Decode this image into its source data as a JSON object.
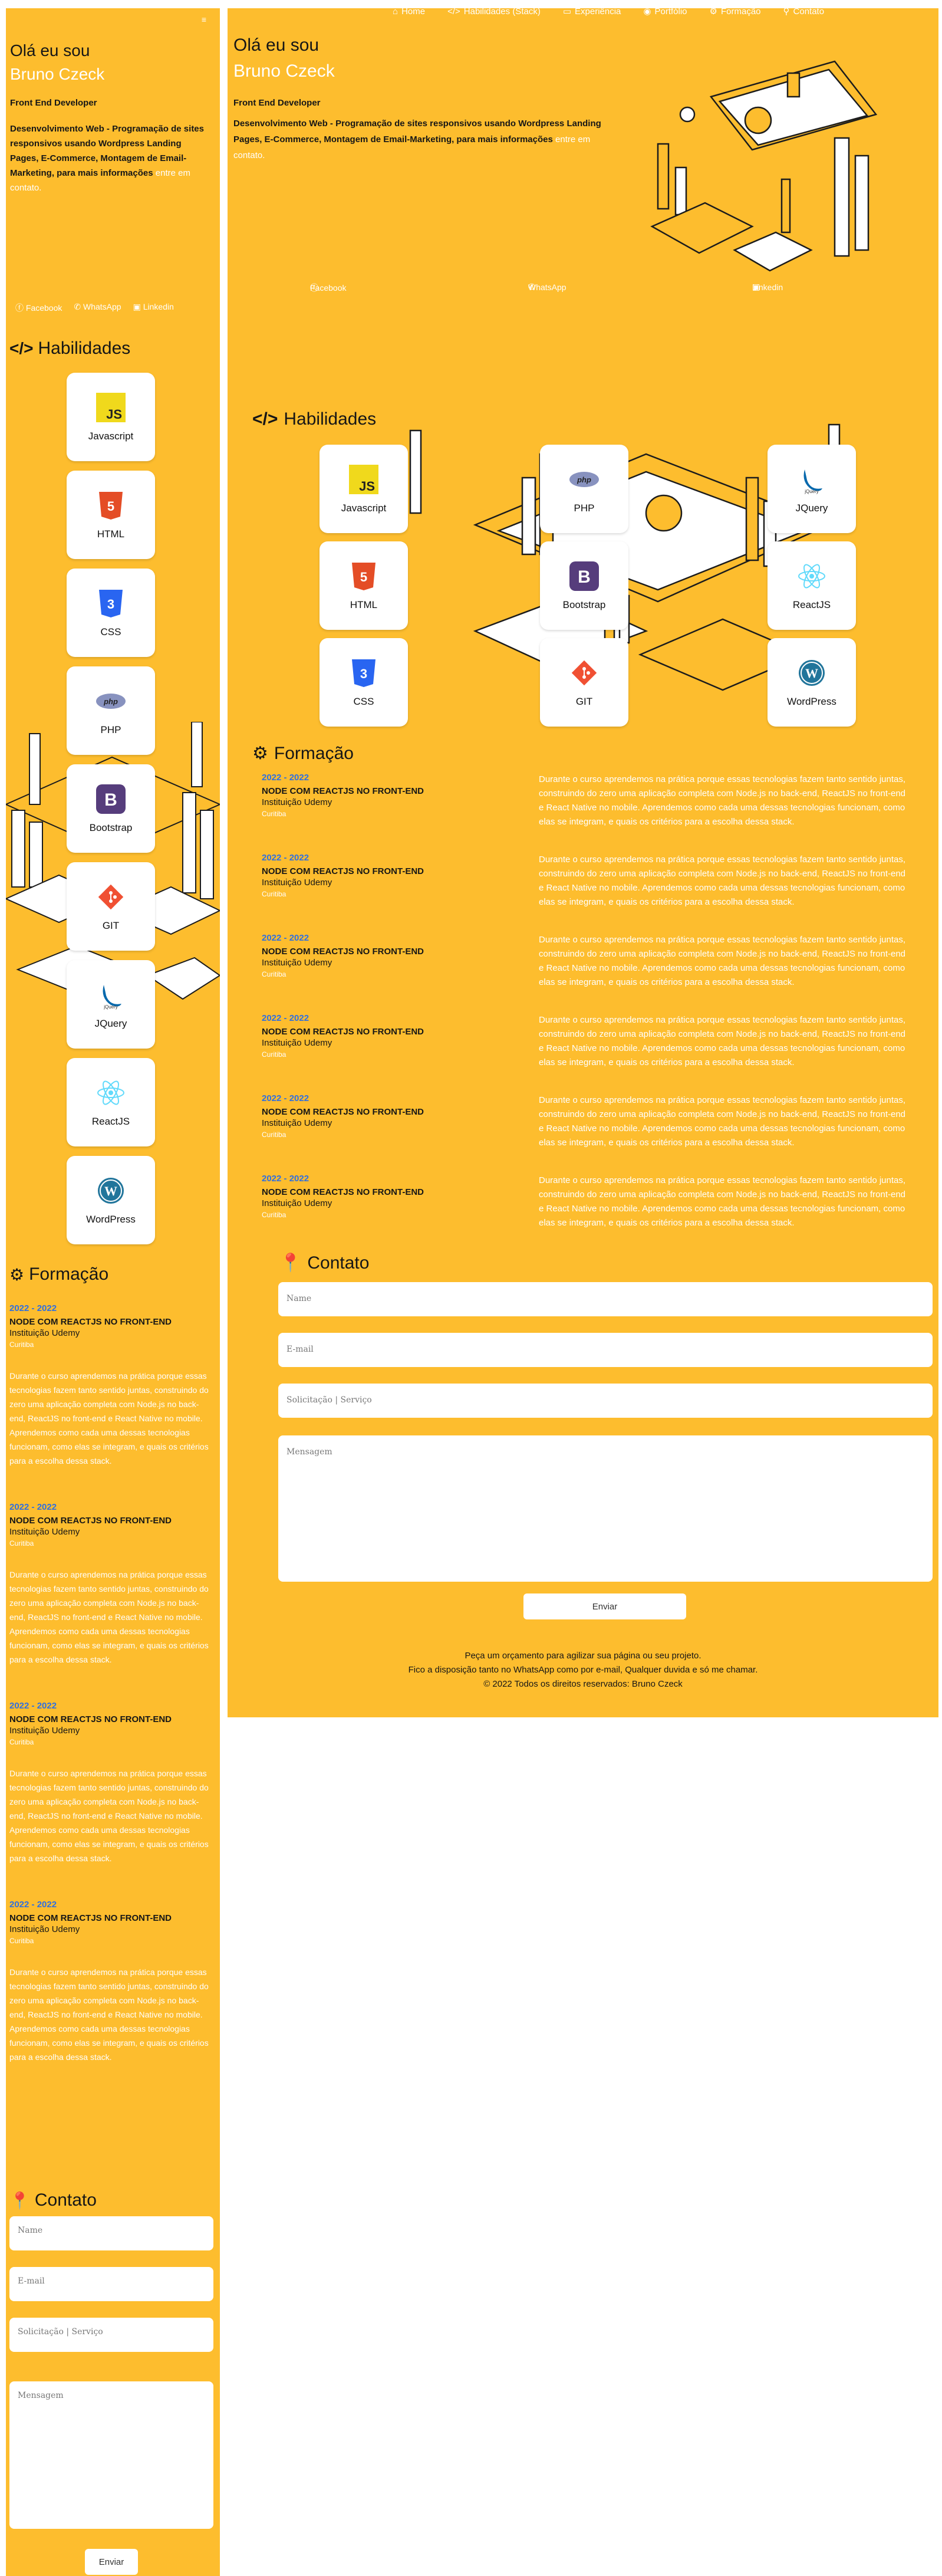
{
  "nav": [
    "Home",
    "Habilidades (Stack)",
    "Experiência",
    "Portfólio",
    "Formação",
    "Contato"
  ],
  "hero": {
    "hello": "Olá eu sou",
    "name": "Bruno Czeck",
    "role": "Front End Developer",
    "description_bold": "Desenvolvimento Web - Programação de sites responsivos usando Wordpress Landing Pages, E-Commerce, Montagem de Email-Marketing, para mais informações",
    "description_link": "entre em contato.",
    "mobile_description_bold": "Desenvolvimento Web - Programação de sites responsivos usando Wordpress Landing Pages, E-Commerce, Montagem de Email-Marketing, para mais informações",
    "menu_toggle": "≡"
  },
  "social": [
    "Facebook",
    "WhatsApp",
    "Linkedin"
  ],
  "skills_title": "Habilidades",
  "skills": [
    {
      "label": "Javascript",
      "icon": "js-icon"
    },
    {
      "label": "HTML",
      "icon": "html5-icon"
    },
    {
      "label": "CSS",
      "icon": "css3-icon"
    },
    {
      "label": "PHP",
      "icon": "php-icon"
    },
    {
      "label": "Bootstrap",
      "icon": "bootstrap-icon"
    },
    {
      "label": "GIT",
      "icon": "git-icon"
    },
    {
      "label": "JQuery",
      "icon": "jquery-icon"
    },
    {
      "label": "ReactJS",
      "icon": "react-icon"
    },
    {
      "label": "WordPress",
      "icon": "wordpress-icon"
    }
  ],
  "education_title": "Formação",
  "education": [
    {
      "year": "2022 - 2022",
      "title": "NODE COM REACTJS NO FRONT-END",
      "institution": "Instituição Udemy",
      "city": "Curitiba",
      "desc": "Durante o curso aprendemos na prática porque essas tecnologias fazem tanto sentido juntas, construindo do zero uma aplicação completa com Node.js no back-end, ReactJS no front-end e React Native no mobile. Aprendemos como cada uma dessas tecnologias funcionam, como elas se integram, e quais os critérios para a escolha dessa stack."
    },
    {
      "year": "2022 - 2022",
      "title": "NODE COM REACTJS NO FRONT-END",
      "institution": "Instituição Udemy",
      "city": "Curitiba",
      "desc": "Durante o curso aprendemos na prática porque essas tecnologias fazem tanto sentido juntas, construindo do zero uma aplicação completa com Node.js no back-end, ReactJS no front-end e React Native no mobile. Aprendemos como cada uma dessas tecnologias funcionam, como elas se integram, e quais os critérios para a escolha dessa stack."
    },
    {
      "year": "2022 - 2022",
      "title": "NODE COM REACTJS NO FRONT-END",
      "institution": "Instituição Udemy",
      "city": "Curitiba",
      "desc": "Durante o curso aprendemos na prática porque essas tecnologias fazem tanto sentido juntas, construindo do zero uma aplicação completa com Node.js no back-end, ReactJS no front-end e React Native no mobile. Aprendemos como cada uma dessas tecnologias funcionam, como elas se integram, e quais os critérios para a escolha dessa stack."
    },
    {
      "year": "2022 - 2022",
      "title": "NODE COM REACTJS NO FRONT-END",
      "institution": "Instituição Udemy",
      "city": "Curitiba",
      "desc": "Durante o curso aprendemos na prática porque essas tecnologias fazem tanto sentido juntas, construindo do zero uma aplicação completa com Node.js no back-end, ReactJS no front-end e React Native no mobile. Aprendemos como cada uma dessas tecnologias funcionam, como elas se integram, e quais os critérios para a escolha dessa stack."
    },
    {
      "year": "2022 - 2022",
      "title": "NODE COM REACTJS NO FRONT-END",
      "institution": "Instituição Udemy",
      "city": "Curitiba",
      "desc": "Durante o curso aprendemos na prática porque essas tecnologias fazem tanto sentido juntas, construindo do zero uma aplicação completa com Node.js no back-end, ReactJS no front-end e React Native no mobile. Aprendemos como cada uma dessas tecnologias funcionam, como elas se integram, e quais os critérios para a escolha dessa stack."
    },
    {
      "year": "2022 - 2022",
      "title": "NODE COM REACTJS NO FRONT-END",
      "institution": "Instituição Udemy",
      "city": "Curitiba",
      "desc": "Durante o curso aprendemos na prática porque essas tecnologias fazem tanto sentido juntas, construindo do zero uma aplicação completa com Node.js no back-end, ReactJS no front-end e React Native no mobile. Aprendemos como cada uma dessas tecnologias funcionam, como elas se integram, e quais os critérios para a escolha dessa stack."
    }
  ],
  "contact": {
    "title": "Contato",
    "name_placeholder": "Name",
    "email_placeholder": "E-mail",
    "subject_placeholder": "Solicitação | Serviço",
    "message_placeholder": "Mensagem",
    "submit": "Enviar"
  },
  "footer": {
    "line1": "Peça um orçamento para agilizar sua página ou seu projeto.",
    "line2": "Fico a disposição tanto no WhatsApp como por e-mail, Qualquer duvida e só me chamar.",
    "line3": "© 2022 Todos os direitos reservados: Bruno Czeck"
  },
  "colors": {
    "accent": "#fdbd2e",
    "link": "#2f6fe0",
    "text": "#161616"
  }
}
